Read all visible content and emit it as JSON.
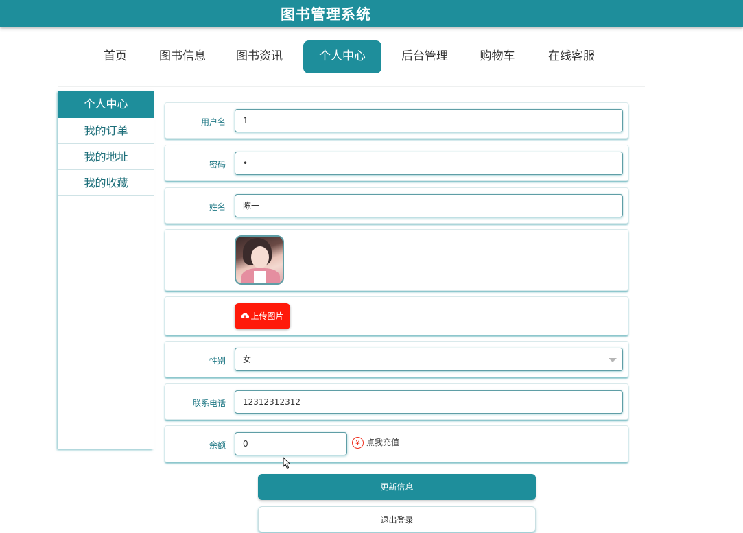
{
  "header": {
    "title": "图书管理系统"
  },
  "nav": {
    "items": [
      {
        "label": "首页"
      },
      {
        "label": "图书信息"
      },
      {
        "label": "图书资讯"
      },
      {
        "label": "个人中心"
      },
      {
        "label": "后台管理"
      },
      {
        "label": "购物车"
      },
      {
        "label": "在线客服"
      }
    ],
    "active_index": 3
  },
  "sidebar": {
    "items": [
      {
        "label": "个人中心"
      },
      {
        "label": "我的订单"
      },
      {
        "label": "我的地址"
      },
      {
        "label": "我的收藏"
      }
    ]
  },
  "form": {
    "username": {
      "label": "用户名",
      "value": "1"
    },
    "password": {
      "label": "密码",
      "value": "•"
    },
    "name": {
      "label": "姓名",
      "value": "陈一"
    },
    "upload": {
      "label": "上传图片",
      "icon": "cloud-upload-icon"
    },
    "gender": {
      "label": "性别",
      "value": "女"
    },
    "phone": {
      "label": "联系电话",
      "value": "12312312312"
    },
    "balance": {
      "label": "余额",
      "value": "0",
      "recharge_label": "点我充值",
      "recharge_icon": "¥"
    }
  },
  "actions": {
    "update_label": "更新信息",
    "logout_label": "退出登录"
  },
  "colors": {
    "primary": "#1e8e9b",
    "upload": "#ff1a0a",
    "yen": "#ee3322"
  }
}
